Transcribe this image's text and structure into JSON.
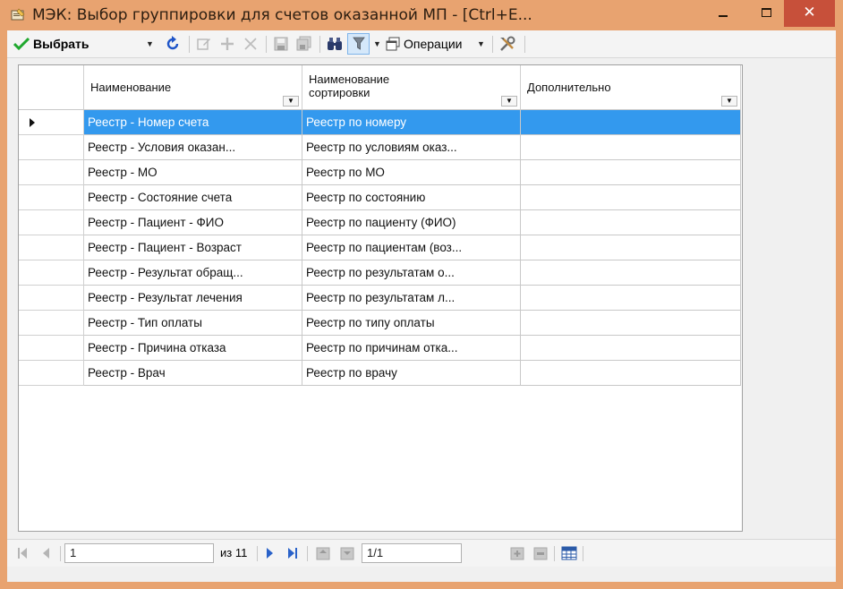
{
  "window": {
    "title": "МЭК: Выбор группировки для счетов оказанной МП - [Ctrl+E...",
    "close_glyph": "✕"
  },
  "toolbar": {
    "select_label": "Выбрать",
    "operations_label": "Операции"
  },
  "grid": {
    "columns": [
      {
        "label": "Наименование"
      },
      {
        "label_line1": "Наименование",
        "label_line2": "сортировки"
      },
      {
        "label": "Дополнительно"
      }
    ],
    "rows": [
      {
        "name": "Реестр - Номер счета",
        "sort": "Реестр по номеру",
        "extra": ""
      },
      {
        "name": "Реестр - Условия оказан...",
        "sort": "Реестр по условиям оказ...",
        "extra": ""
      },
      {
        "name": "Реестр - МО",
        "sort": "Реестр по МО",
        "extra": ""
      },
      {
        "name": "Реестр - Состояние счета",
        "sort": "Реестр по состоянию",
        "extra": ""
      },
      {
        "name": "Реестр - Пациент - ФИО",
        "sort": "Реестр по пациенту (ФИО)",
        "extra": ""
      },
      {
        "name": "Реестр - Пациент - Возраст",
        "sort": "Реестр по пациентам (воз...",
        "extra": ""
      },
      {
        "name": "Реестр - Результат обращ...",
        "sort": "Реестр по результатам о...",
        "extra": ""
      },
      {
        "name": "Реестр - Результат лечения",
        "sort": "Реестр по результатам л...",
        "extra": ""
      },
      {
        "name": "Реестр - Тип оплаты",
        "sort": "Реестр по типу оплаты",
        "extra": ""
      },
      {
        "name": "Реестр - Причина отказа",
        "sort": "Реестр по причинам отка...",
        "extra": ""
      },
      {
        "name": "Реестр - Врач",
        "sort": "Реестр по врачу",
        "extra": ""
      }
    ],
    "selected_row": 0
  },
  "navigator": {
    "current_page": "1",
    "of_label": "из 11",
    "position": "1/1"
  },
  "colors": {
    "title_bar": "#e8a370",
    "close_button": "#c7503a",
    "selection": "#3399ee"
  }
}
